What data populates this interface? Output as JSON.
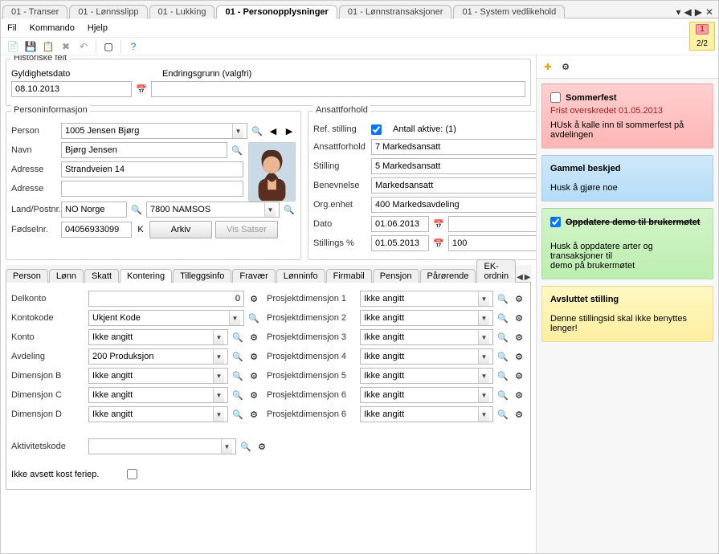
{
  "top_tabs": {
    "items": [
      {
        "label": "01 - Transer"
      },
      {
        "label": "01 - Lønnsslipp"
      },
      {
        "label": "01 - Lukking"
      },
      {
        "label": "01 - Personopplysninger"
      },
      {
        "label": "01 - Lønnstransaksjoner"
      },
      {
        "label": "01 - System vedlikehold"
      }
    ],
    "active_index": 3
  },
  "menu": {
    "fil": "Fil",
    "kommando": "Kommando",
    "hjelp": "Hjelp"
  },
  "badge": {
    "count": "1",
    "page": "2/2"
  },
  "historiske": {
    "legend": "Historiske felt",
    "gyldighetsdato_label": "Gyldighetsdato",
    "gyldighetsdato_value": "08.10.2013",
    "endringsgrunn_label": "Endringsgrunn (valgfri)",
    "endringsgrunn_value": ""
  },
  "personinfo": {
    "legend": "Personinformasjon",
    "person_label": "Person",
    "person_value": "1005 Jensen Bjørg",
    "navn_label": "Navn",
    "navn_value": "Bjørg Jensen",
    "adresse_label": "Adresse",
    "adresse_value": "Strandveien 14",
    "adresse2_label": "Adresse",
    "adresse2_value": "",
    "landpostnr_label": "Land/Postnr.",
    "land_value": "NO Norge",
    "postnr_value": "7800 NAMSOS",
    "fodselnr_label": "Fødselnr.",
    "fodselnr_value": "04056933099",
    "k_label": "K",
    "arkiv_btn": "Arkiv",
    "vis_satser_btn": "Vis Satser"
  },
  "ansatt": {
    "legend": "Ansattforhold",
    "ref_stilling_label": "Ref. stilling",
    "antall_aktive_label": "Antall aktive: (1)",
    "ansattforhold_label": "Ansattforhold",
    "ansattforhold_value": "7 Markedsansatt",
    "stilling_label": "Stilling",
    "stilling_value": "5 Markedsansatt",
    "benevnelse_label": "Benevnelse",
    "benevnelse_value": "Markedsansatt",
    "orgenhet_label": "Org.enhet",
    "orgenhet_value": "400 Markedsavdeling",
    "dato_label": "Dato",
    "dato1_value": "01.06.2013",
    "stillingspct_label": "Stillings %",
    "dato2_value": "01.05.2013",
    "pct_value": "100"
  },
  "inner_tabs": {
    "items": [
      {
        "label": "Person"
      },
      {
        "label": "Lønn"
      },
      {
        "label": "Skatt"
      },
      {
        "label": "Kontering"
      },
      {
        "label": "Tilleggsinfo"
      },
      {
        "label": "Fravær"
      },
      {
        "label": "Lønninfo"
      },
      {
        "label": "Firmabil"
      },
      {
        "label": "Pensjon"
      },
      {
        "label": "Pårørende"
      },
      {
        "label": "EK-ordnin"
      }
    ],
    "active_index": 3
  },
  "kontering": {
    "delkonto_label": "Delkonto",
    "delkonto_value": "0",
    "kontokode_label": "Kontokode",
    "kontokode_value": "Ukjent Kode",
    "konto_label": "Konto",
    "konto_value": "Ikke angitt",
    "avdeling_label": "Avdeling",
    "avdeling_value": "200 Produksjon",
    "dimB_label": "Dimensjon B",
    "dimB_value": "Ikke angitt",
    "dimC_label": "Dimensjon C",
    "dimC_value": "Ikke angitt",
    "dimD_label": "Dimensjon D",
    "dimD_value": "Ikke angitt",
    "pdim1_label": "Prosjektdimensjon 1",
    "pdim2_label": "Prosjektdimensjon 2",
    "pdim3_label": "Prosjektdimensjon 3",
    "pdim4_label": "Prosjektdimensjon 4",
    "pdim5_label": "Prosjektdimensjon 5",
    "pdim6_label": "Prosjektdimensjon 6",
    "pdim7_label": "Prosjektdimensjon 6",
    "pdim_value": "Ikke angitt",
    "aktivitet_label": "Aktivitetskode",
    "aktivitet_value": "",
    "ikke_avsett_label": "Ikke avsett kost feriep."
  },
  "notes": [
    {
      "color": "red",
      "checked": false,
      "title": "Sommerfest",
      "deadline": "Frist overskredet 01.05.2013",
      "body": "HUsk å kalle inn til sommerfest på avdelingen"
    },
    {
      "color": "blue",
      "checked": null,
      "title": "Gammel beskjed",
      "deadline": "",
      "body": "Husk å gjøre noe"
    },
    {
      "color": "green",
      "checked": true,
      "title": "Oppdatere demo til brukermøtet",
      "deadline": "",
      "body": "Husk å oppdatere arter og transaksjoner til\n demo på brukermøtet"
    },
    {
      "color": "yellow",
      "checked": null,
      "title": "Avsluttet stilling",
      "deadline": "",
      "body": "Denne stillingsid skal ikke benyttes lenger!"
    }
  ]
}
